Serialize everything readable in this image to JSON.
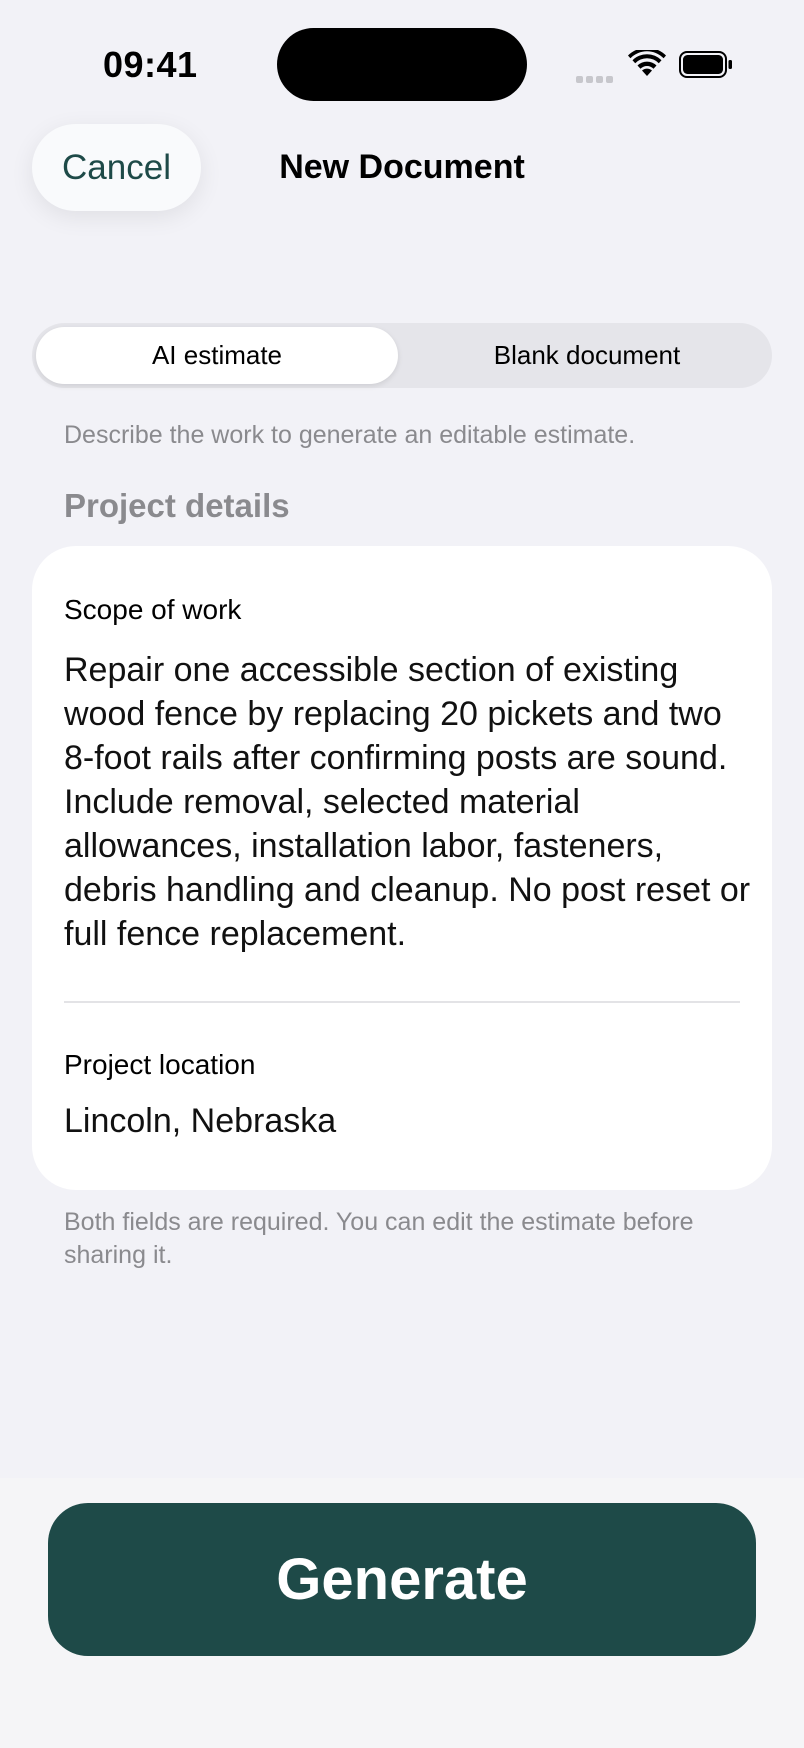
{
  "status_bar": {
    "time": "09:41"
  },
  "nav": {
    "cancel_label": "Cancel",
    "title": "New Document"
  },
  "mode_picker": {
    "options": [
      {
        "label": "AI estimate",
        "selected": true
      },
      {
        "label": "Blank document",
        "selected": false
      }
    ]
  },
  "helper_text": "Describe the work to generate an editable estimate.",
  "section_header": "Project details",
  "form": {
    "scope": {
      "label": "Scope of work",
      "value": "Repair one accessible section of existing wood fence by replacing 20 pickets and two 8-foot rails after confirming posts are sound. Include removal, selected material allowances, installation labor, fasteners, debris handling and cleanup. No post reset or full fence replacement."
    },
    "location": {
      "label": "Project location",
      "value": "Lincoln, Nebraska"
    }
  },
  "footnote": "Both fields are required. You can edit the estimate before sharing it.",
  "generate_label": "Generate",
  "colors": {
    "accent": "#1e4a48",
    "background": "#f2f2f7",
    "secondary_text": "#8a8a8e"
  },
  "icons": [
    "cellular-signal-icon",
    "wifi-icon",
    "battery-icon"
  ]
}
